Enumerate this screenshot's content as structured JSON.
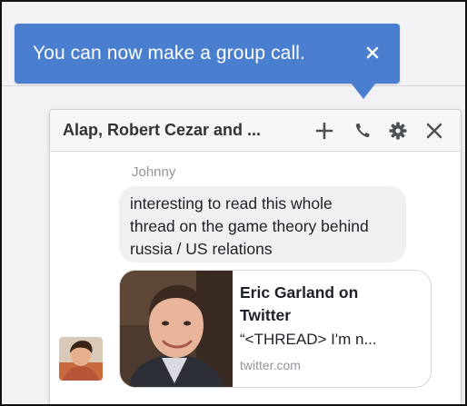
{
  "tooltip": {
    "text": "You can now make a group call.",
    "close_icon": "close-icon",
    "bg_color": "#4a7fcf"
  },
  "chat": {
    "title": "Alap, Robert Cezar and ...",
    "header_icons": [
      "add-icon",
      "phone-icon",
      "gear-icon",
      "close-icon"
    ],
    "messages": [
      {
        "sender": "Johnny",
        "text_lines": [
          "interesting to read this whole",
          "thread on the game theory behind",
          "russia / US relations"
        ]
      }
    ],
    "link_preview": {
      "title_lines": [
        "Eric Garland on",
        "Twitter"
      ],
      "description": "“<THREAD> I'm n...",
      "domain": "twitter.com",
      "thumbnail_icon": "profile-photo"
    },
    "avatar_icon": "user-avatar"
  }
}
